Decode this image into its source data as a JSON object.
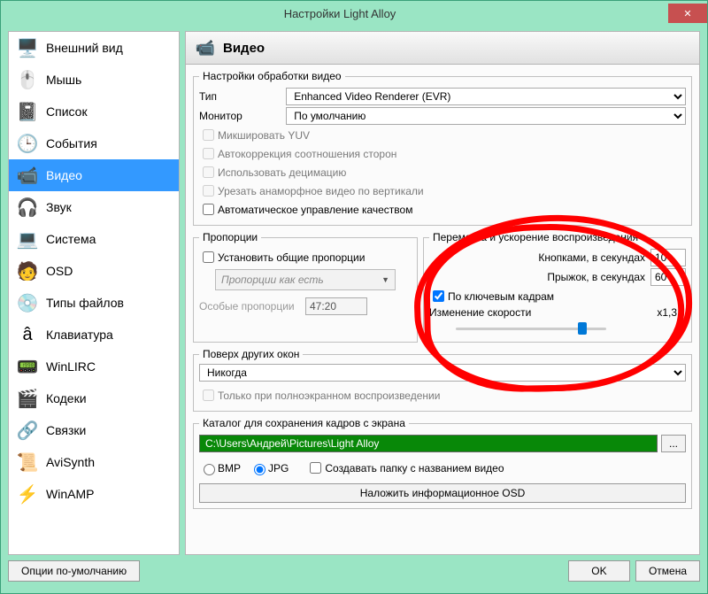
{
  "window": {
    "title": "Настройки Light Alloy"
  },
  "sidebar": {
    "items": [
      {
        "label": "Внешний вид",
        "icon": "🖥️"
      },
      {
        "label": "Мышь",
        "icon": "🖱️"
      },
      {
        "label": "Список",
        "icon": "📓"
      },
      {
        "label": "События",
        "icon": "🕒"
      },
      {
        "label": "Видео",
        "icon": "📹",
        "selected": true
      },
      {
        "label": "Звук",
        "icon": "🎧"
      },
      {
        "label": "Система",
        "icon": "💻"
      },
      {
        "label": "OSD",
        "icon": "🧑"
      },
      {
        "label": "Типы файлов",
        "icon": "💿"
      },
      {
        "label": "Клавиатура",
        "icon": "â"
      },
      {
        "label": "WinLIRC",
        "icon": "📟"
      },
      {
        "label": "Кодеки",
        "icon": "🎬"
      },
      {
        "label": "Связки",
        "icon": "🔗"
      },
      {
        "label": "AviSynth",
        "icon": "📜"
      },
      {
        "label": "WinAMP",
        "icon": "⚡"
      }
    ]
  },
  "header": {
    "title": "Видео"
  },
  "processing": {
    "legend": "Настройки обработки видео",
    "type_label": "Тип",
    "type_value": "Enhanced Video Renderer (EVR)",
    "monitor_label": "Монитор",
    "monitor_value": "По умолчанию",
    "cb1": "Микшировать YUV",
    "cb2": "Автокоррекция соотношения сторон",
    "cb3": "Использовать децимацию",
    "cb4": "Урезать анаморфное видео по вертикали",
    "cb5": "Автоматическое управление качеством"
  },
  "aspect": {
    "legend": "Пропорции",
    "common_label": "Установить общие пропорции",
    "dd_value": "Пропорции как есть",
    "custom_label": "Особые пропорции",
    "custom_value": "47:20"
  },
  "playback": {
    "legend": "Перемотка и ускорение воспроизведения",
    "buttons_label": "Кнопками, в секундах",
    "buttons_value": "10",
    "jump_label": "Прыжок, в секундах",
    "jump_value": "60",
    "keyframe_label": "По ключевым кадрам",
    "speed_label": "Изменение скорости",
    "speed_value": "x1,3"
  },
  "ontop": {
    "legend": "Поверх других окон",
    "value": "Никогда",
    "fullscreen_only": "Только при полноэкранном воспроизведении"
  },
  "capture": {
    "legend": "Каталог для сохранения кадров с экрана",
    "path": "C:\\Users\\Андрей\\Pictures\\Light Alloy",
    "browse": "...",
    "fmt_bmp": "BMP",
    "fmt_jpg": "JPG",
    "folder_cb": "Создавать папку с названием видео",
    "osd_btn": "Наложить информационное OSD"
  },
  "footer": {
    "defaults": "Опции по-умолчанию",
    "ok": "OK",
    "cancel": "Отмена"
  }
}
